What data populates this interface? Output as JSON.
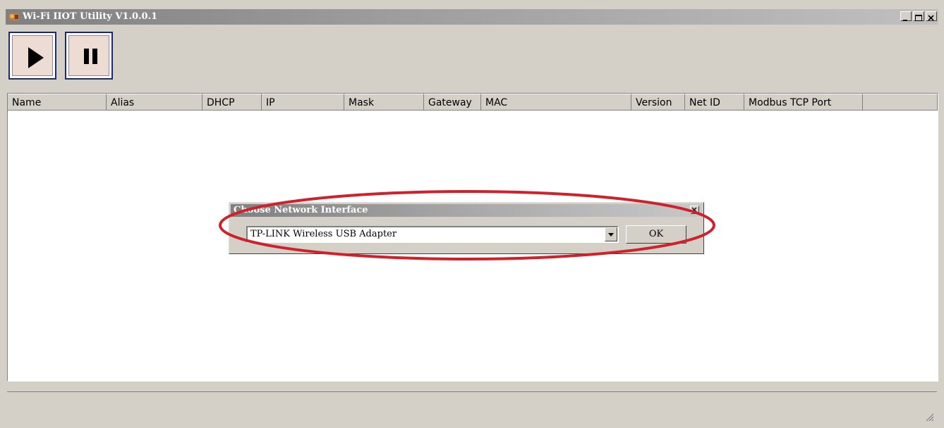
{
  "window": {
    "title": "Wi-Fi IIOT Utility V1.0.0.1",
    "icon": "app-icon",
    "controls": [
      "minimize-icon",
      "maximize-icon",
      "close-icon"
    ]
  },
  "toolbar": {
    "buttons": [
      {
        "name": "play",
        "icon": "play-icon"
      },
      {
        "name": "pause",
        "icon": "pause-icon"
      }
    ]
  },
  "list": {
    "columns": [
      "Name",
      "Alias",
      "DHCP",
      "IP",
      "Mask",
      "Gateway",
      "MAC",
      "Version",
      "Net ID",
      "Modbus TCP Port"
    ],
    "rows": []
  },
  "dialog": {
    "title": "Choose Network Interface",
    "selected_interface": "TP-LINK Wireless USB Adapter",
    "ok_label": "OK",
    "highlight_color": "#d0202a"
  }
}
